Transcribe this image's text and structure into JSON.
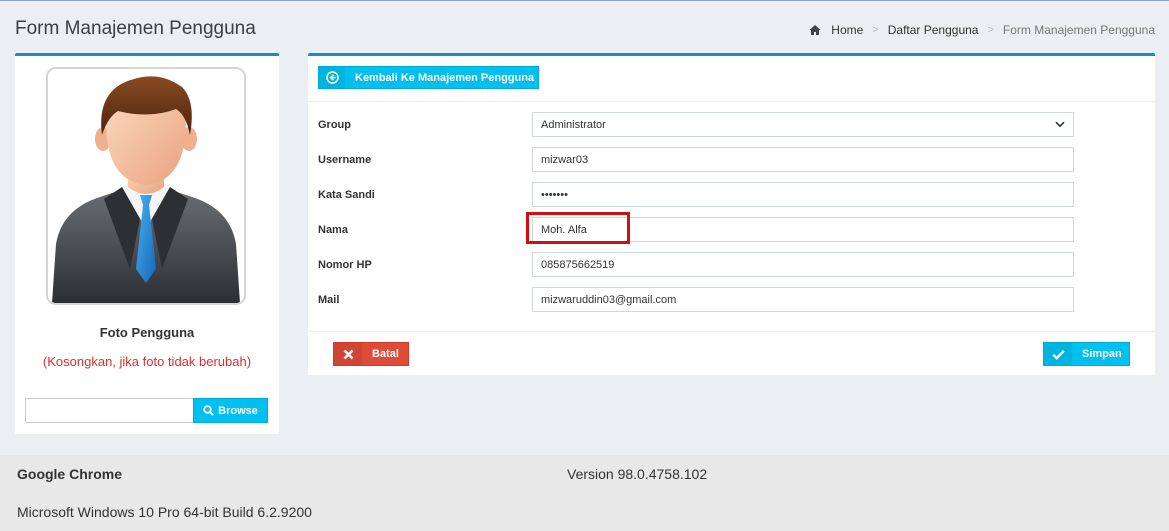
{
  "header": {
    "title": "Form Manajemen Pengguna",
    "breadcrumb": [
      "Home",
      "Daftar Pengguna",
      "Form Manajemen Pengguna"
    ]
  },
  "photo": {
    "label": "Foto Pengguna",
    "hint": "(Kosongkan, jika foto tidak berubah)",
    "file_value": "",
    "browse_label": "Browse"
  },
  "form": {
    "back_label": "Kembali Ke Manajemen Pengguna",
    "fields": [
      {
        "label": "Group",
        "value": "Administrator",
        "type": "select"
      },
      {
        "label": "Username",
        "value": "mizwar03",
        "type": "text"
      },
      {
        "label": "Kata Sandi",
        "value": "•••••••",
        "type": "password"
      },
      {
        "label": "Nama",
        "value": "Moh. Alfa",
        "type": "text"
      },
      {
        "label": "Nomor HP",
        "value": "085875662519",
        "type": "text"
      },
      {
        "label": "Mail",
        "value": "mizwaruddin03@gmail.com",
        "type": "text"
      }
    ],
    "cancel_label": "Batal",
    "save_label": "Simpan"
  },
  "footer": {
    "browser": "Google Chrome",
    "version": "Version 98.0.4758.102",
    "os": "Microsoft Windows 10 Pro 64-bit Build 6.2.9200"
  },
  "colors": {
    "accent": "#00c0ef",
    "danger": "#dd4b39",
    "panel_border": "#1e8ac0",
    "highlight": "#d30f0f"
  }
}
